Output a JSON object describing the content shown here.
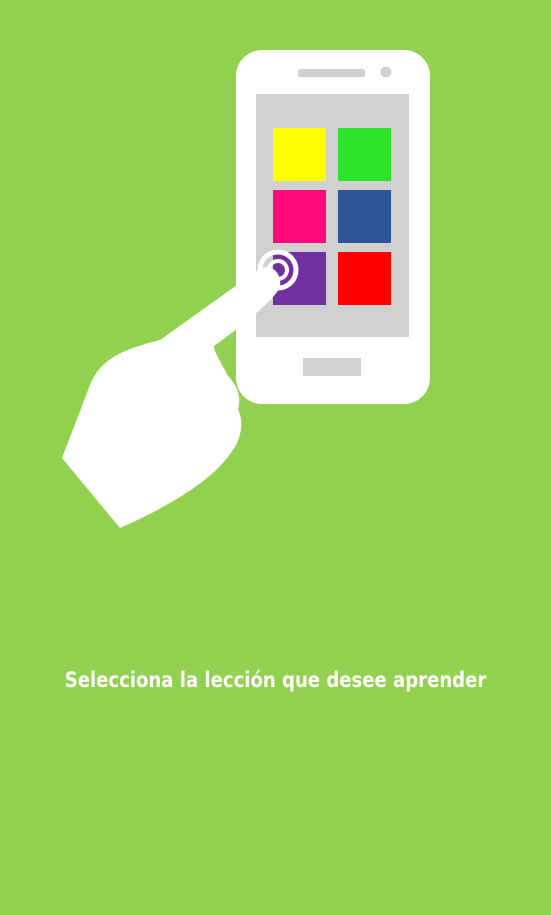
{
  "colors": {
    "background": "#92d050",
    "phone_body": "#ffffff",
    "phone_screen": "#d0d0d0",
    "hand": "#ffffff",
    "text": "#ffffff"
  },
  "tiles": [
    {
      "name": "yellow",
      "color": "#ffff00"
    },
    {
      "name": "green",
      "color": "#2ce22a"
    },
    {
      "name": "pink",
      "color": "#ff0a78"
    },
    {
      "name": "blue",
      "color": "#2e5597"
    },
    {
      "name": "purple",
      "color": "#7030a0"
    },
    {
      "name": "red",
      "color": "#ff0000"
    }
  ],
  "icons": [
    "smartphone-icon",
    "pointing-hand-icon",
    "tap-ripple-icon"
  ],
  "instruction": "Selecciona la lección que desee aprender"
}
